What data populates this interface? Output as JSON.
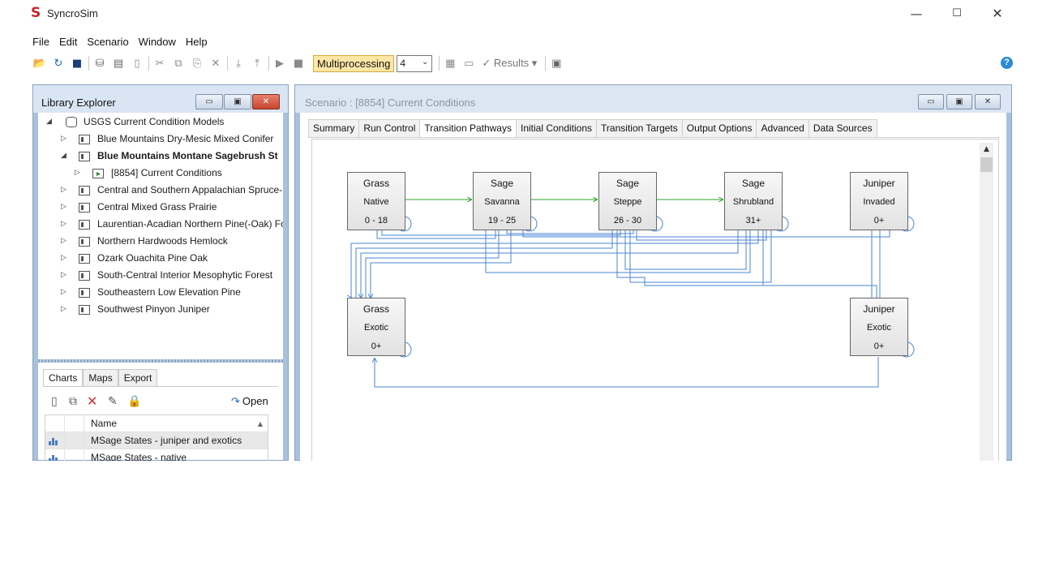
{
  "window": {
    "logo": "S",
    "title": "SyncroSim",
    "controls": {
      "minimize": "—",
      "maximize": "☐",
      "close": "✕"
    }
  },
  "menu": [
    "File",
    "Edit",
    "Scenario",
    "Window",
    "Help"
  ],
  "toolbar": {
    "multiprocessing_label": "Multiprocessing",
    "processors_value": "4",
    "results_label": "✓ Results ▾",
    "help_glyph": "?"
  },
  "library_explorer": {
    "title": "Library Explorer",
    "root": "USGS Current Condition Models",
    "items": [
      "Blue Mountains Dry-Mesic Mixed Conifer",
      "Blue Mountains Montane Sagebrush St",
      "[8854] Current Conditions",
      "Central and Southern Appalachian Spruce-F",
      "Central Mixed Grass Prairie",
      "Laurentian-Acadian Northern Pine(-Oak) Fo",
      "Northern Hardwoods Hemlock",
      "Ozark Ouachita Pine Oak",
      "South-Central Interior Mesophytic Forest",
      "Southeastern Low Elevation Pine",
      "Southwest Pinyon Juniper"
    ],
    "bottom_tabs": [
      "Charts",
      "Maps",
      "Export"
    ],
    "open_label": "Open",
    "table_header": "Name",
    "charts": [
      "MSage States - juniper and exotics",
      "MSage States - native"
    ]
  },
  "scenario": {
    "title": "Scenario : [8854] Current Conditions",
    "tabs": [
      "Summary",
      "Run Control",
      "Transition Pathways",
      "Initial Conditions",
      "Transition Targets",
      "Output Options",
      "Advanced",
      "Data Sources"
    ],
    "active_tab": "Transition Pathways",
    "states": [
      {
        "l1": "Grass",
        "l2": "Native",
        "l3": "0 - 18"
      },
      {
        "l1": "Sage",
        "l2": "Savanna",
        "l3": "19 - 25"
      },
      {
        "l1": "Sage",
        "l2": "Steppe",
        "l3": "26 - 30"
      },
      {
        "l1": "Sage",
        "l2": "Shrubland",
        "l3": "31+"
      },
      {
        "l1": "Juniper",
        "l2": "Invaded",
        "l3": "0+"
      },
      {
        "l1": "Grass",
        "l2": "Exotic",
        "l3": "0+"
      },
      {
        "l1": "Juniper",
        "l2": "Exotic",
        "l3": "0+"
      }
    ]
  },
  "colors": {
    "succession": "#2ca02c",
    "transition": "#4a86d6",
    "accent": "#c0272d"
  }
}
